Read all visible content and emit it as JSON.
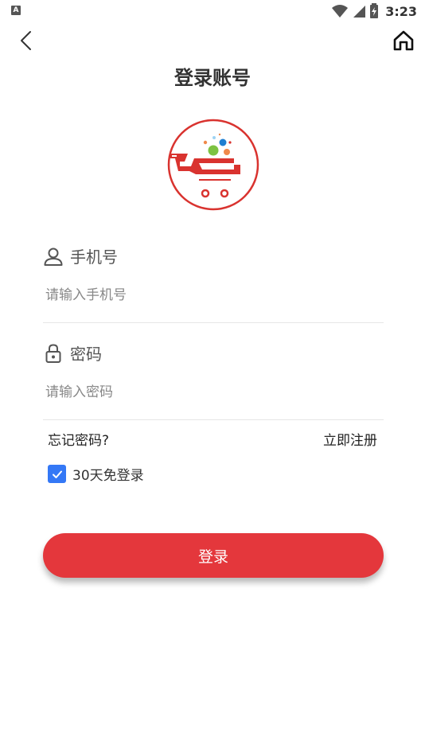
{
  "status_bar": {
    "app_icon_letter": "A",
    "time": "3:23",
    "icons": [
      "wifi-icon",
      "signal-icon",
      "battery-charging-icon"
    ]
  },
  "nav": {
    "title": "登录账号",
    "icons": [
      "back-chevron-icon",
      "home-icon"
    ]
  },
  "logo": {
    "icon": "shopping-cart-logo",
    "colors": {
      "ring": "#d9332f",
      "cart": "#d9332f",
      "dot_green": "#7cc242",
      "dot_blue": "#1f7fd1",
      "dot_orange": "#f0894b"
    }
  },
  "phone_field": {
    "label": "手机号",
    "placeholder": "请输入手机号",
    "value": "",
    "icon": "user-icon"
  },
  "password_field": {
    "label": "密码",
    "placeholder": "请输入密码",
    "value": "",
    "icon": "lock-icon"
  },
  "links": {
    "forgot_password": "忘记密码?",
    "register": "立即注册"
  },
  "remember": {
    "label": "30天免登录",
    "checked": true,
    "color": "#3478f6"
  },
  "login_button": {
    "label": "登录",
    "color": "#e4373c"
  }
}
